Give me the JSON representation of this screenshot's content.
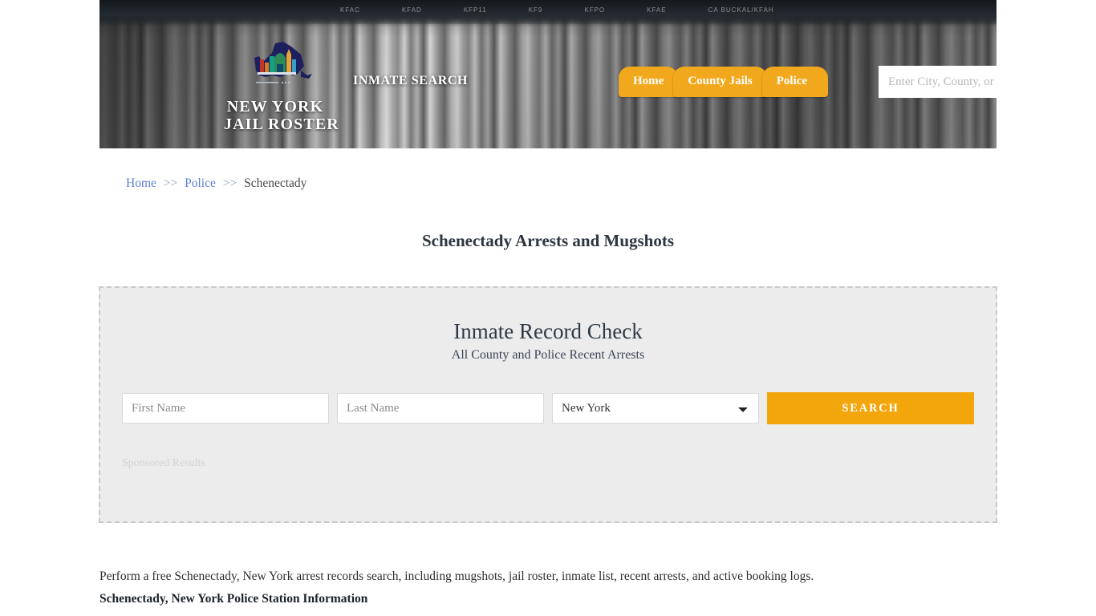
{
  "header": {
    "logo": {
      "icon": "new-york-state-outline-icon",
      "line1": "NEW YORK",
      "line2": "JAIL ROSTER"
    },
    "tagline": "INMATE SEARCH",
    "shelf_labels": [
      "KFAC",
      "KFAD",
      "KFP11",
      "KF9",
      "KFPO",
      "KFAE",
      "CA BUCKAL/KFAH"
    ],
    "nav": [
      {
        "label": "Home"
      },
      {
        "label": "County Jails"
      },
      {
        "label": "Police"
      }
    ],
    "search": {
      "placeholder": "Enter City, County, or Facility",
      "value": "",
      "button_icon": "search-icon"
    }
  },
  "breadcrumb": {
    "items": [
      {
        "label": "Home",
        "link": true
      },
      {
        "label": "Police",
        "link": true
      },
      {
        "label": "Schenectady",
        "link": false
      }
    ],
    "separator": ">>"
  },
  "page_title": "Schenectady Arrests and Mugshots",
  "record_check": {
    "title": "Inmate Record Check",
    "subtitle": "All County and Police Recent Arrests",
    "first_name": {
      "placeholder": "First Name",
      "value": ""
    },
    "last_name": {
      "placeholder": "Last Name",
      "value": ""
    },
    "state": {
      "selected": "New York",
      "options": [
        "New York"
      ]
    },
    "search_button": "SEARCH",
    "sponsored_label": "Sponsored Results"
  },
  "content": {
    "intro": "Perform a free Schenectady, New York arrest records search, including mugshots, jail roster, inmate list, recent arrests, and active booking logs.",
    "section_heading": "Schenectady, New York Police Station Information"
  },
  "colors": {
    "accent_orange": "#F2A81C",
    "button_orange": "#F2A60C",
    "link_blue": "#5b7fd4",
    "panel_bg": "#ECECEC",
    "panel_border": "#c9c9c9",
    "title_dark": "#2d3540"
  }
}
